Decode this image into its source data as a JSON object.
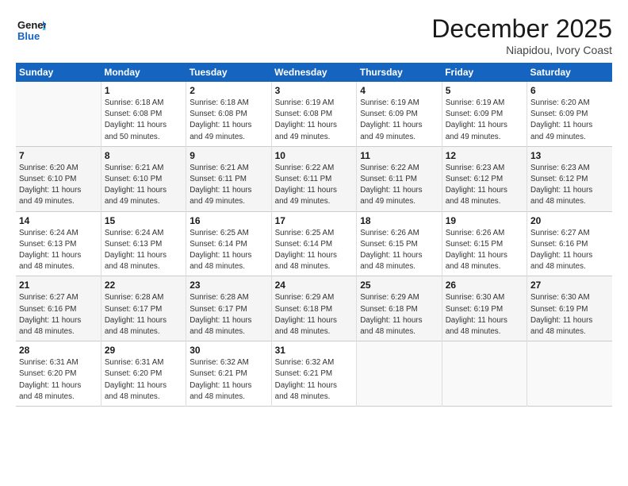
{
  "header": {
    "logo_line1": "General",
    "logo_line2": "Blue",
    "month": "December 2025",
    "location": "Niapidou, Ivory Coast"
  },
  "weekdays": [
    "Sunday",
    "Monday",
    "Tuesday",
    "Wednesday",
    "Thursday",
    "Friday",
    "Saturday"
  ],
  "weeks": [
    [
      {
        "day": "",
        "info": ""
      },
      {
        "day": "1",
        "info": "Sunrise: 6:18 AM\nSunset: 6:08 PM\nDaylight: 11 hours\nand 50 minutes."
      },
      {
        "day": "2",
        "info": "Sunrise: 6:18 AM\nSunset: 6:08 PM\nDaylight: 11 hours\nand 49 minutes."
      },
      {
        "day": "3",
        "info": "Sunrise: 6:19 AM\nSunset: 6:08 PM\nDaylight: 11 hours\nand 49 minutes."
      },
      {
        "day": "4",
        "info": "Sunrise: 6:19 AM\nSunset: 6:09 PM\nDaylight: 11 hours\nand 49 minutes."
      },
      {
        "day": "5",
        "info": "Sunrise: 6:19 AM\nSunset: 6:09 PM\nDaylight: 11 hours\nand 49 minutes."
      },
      {
        "day": "6",
        "info": "Sunrise: 6:20 AM\nSunset: 6:09 PM\nDaylight: 11 hours\nand 49 minutes."
      }
    ],
    [
      {
        "day": "7",
        "info": "Sunrise: 6:20 AM\nSunset: 6:10 PM\nDaylight: 11 hours\nand 49 minutes."
      },
      {
        "day": "8",
        "info": "Sunrise: 6:21 AM\nSunset: 6:10 PM\nDaylight: 11 hours\nand 49 minutes."
      },
      {
        "day": "9",
        "info": "Sunrise: 6:21 AM\nSunset: 6:11 PM\nDaylight: 11 hours\nand 49 minutes."
      },
      {
        "day": "10",
        "info": "Sunrise: 6:22 AM\nSunset: 6:11 PM\nDaylight: 11 hours\nand 49 minutes."
      },
      {
        "day": "11",
        "info": "Sunrise: 6:22 AM\nSunset: 6:11 PM\nDaylight: 11 hours\nand 49 minutes."
      },
      {
        "day": "12",
        "info": "Sunrise: 6:23 AM\nSunset: 6:12 PM\nDaylight: 11 hours\nand 48 minutes."
      },
      {
        "day": "13",
        "info": "Sunrise: 6:23 AM\nSunset: 6:12 PM\nDaylight: 11 hours\nand 48 minutes."
      }
    ],
    [
      {
        "day": "14",
        "info": "Sunrise: 6:24 AM\nSunset: 6:13 PM\nDaylight: 11 hours\nand 48 minutes."
      },
      {
        "day": "15",
        "info": "Sunrise: 6:24 AM\nSunset: 6:13 PM\nDaylight: 11 hours\nand 48 minutes."
      },
      {
        "day": "16",
        "info": "Sunrise: 6:25 AM\nSunset: 6:14 PM\nDaylight: 11 hours\nand 48 minutes."
      },
      {
        "day": "17",
        "info": "Sunrise: 6:25 AM\nSunset: 6:14 PM\nDaylight: 11 hours\nand 48 minutes."
      },
      {
        "day": "18",
        "info": "Sunrise: 6:26 AM\nSunset: 6:15 PM\nDaylight: 11 hours\nand 48 minutes."
      },
      {
        "day": "19",
        "info": "Sunrise: 6:26 AM\nSunset: 6:15 PM\nDaylight: 11 hours\nand 48 minutes."
      },
      {
        "day": "20",
        "info": "Sunrise: 6:27 AM\nSunset: 6:16 PM\nDaylight: 11 hours\nand 48 minutes."
      }
    ],
    [
      {
        "day": "21",
        "info": "Sunrise: 6:27 AM\nSunset: 6:16 PM\nDaylight: 11 hours\nand 48 minutes."
      },
      {
        "day": "22",
        "info": "Sunrise: 6:28 AM\nSunset: 6:17 PM\nDaylight: 11 hours\nand 48 minutes."
      },
      {
        "day": "23",
        "info": "Sunrise: 6:28 AM\nSunset: 6:17 PM\nDaylight: 11 hours\nand 48 minutes."
      },
      {
        "day": "24",
        "info": "Sunrise: 6:29 AM\nSunset: 6:18 PM\nDaylight: 11 hours\nand 48 minutes."
      },
      {
        "day": "25",
        "info": "Sunrise: 6:29 AM\nSunset: 6:18 PM\nDaylight: 11 hours\nand 48 minutes."
      },
      {
        "day": "26",
        "info": "Sunrise: 6:30 AM\nSunset: 6:19 PM\nDaylight: 11 hours\nand 48 minutes."
      },
      {
        "day": "27",
        "info": "Sunrise: 6:30 AM\nSunset: 6:19 PM\nDaylight: 11 hours\nand 48 minutes."
      }
    ],
    [
      {
        "day": "28",
        "info": "Sunrise: 6:31 AM\nSunset: 6:20 PM\nDaylight: 11 hours\nand 48 minutes."
      },
      {
        "day": "29",
        "info": "Sunrise: 6:31 AM\nSunset: 6:20 PM\nDaylight: 11 hours\nand 48 minutes."
      },
      {
        "day": "30",
        "info": "Sunrise: 6:32 AM\nSunset: 6:21 PM\nDaylight: 11 hours\nand 48 minutes."
      },
      {
        "day": "31",
        "info": "Sunrise: 6:32 AM\nSunset: 6:21 PM\nDaylight: 11 hours\nand 48 minutes."
      },
      {
        "day": "",
        "info": ""
      },
      {
        "day": "",
        "info": ""
      },
      {
        "day": "",
        "info": ""
      }
    ]
  ]
}
